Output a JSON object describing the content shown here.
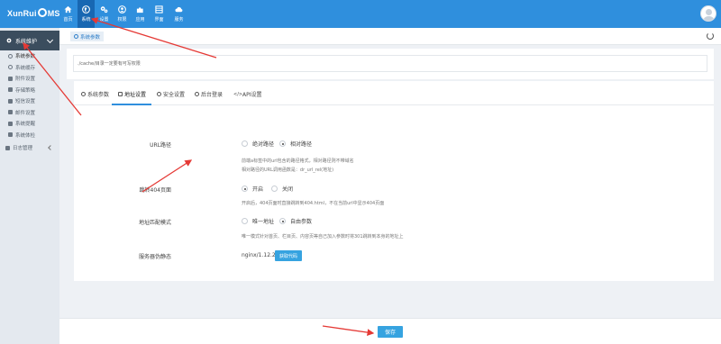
{
  "app": {
    "logo_text_left": "XunRui",
    "logo_text_right": "MS"
  },
  "topnav": {
    "items": [
      {
        "label": "首页",
        "icon": "home-icon",
        "active": false
      },
      {
        "label": "系统",
        "icon": "globe-icon",
        "active": true
      },
      {
        "label": "设置",
        "icon": "gears-icon",
        "active": false
      },
      {
        "label": "权限",
        "icon": "user-circle-icon",
        "active": false
      },
      {
        "label": "应用",
        "icon": "puzzle-icon",
        "active": false
      },
      {
        "label": "界面",
        "icon": "layout-icon",
        "active": false
      },
      {
        "label": "服务",
        "icon": "cloud-icon",
        "active": false
      }
    ]
  },
  "sidebar": {
    "header": "系统维护",
    "items": [
      {
        "label": "系统参数",
        "icon": "gear-icon"
      },
      {
        "label": "系统缓存",
        "icon": "refresh-icon"
      },
      {
        "label": "附件设置",
        "icon": "folder-icon"
      },
      {
        "label": "存储策略",
        "icon": "cloud-icon"
      },
      {
        "label": "短信设置",
        "icon": "envelope-icon"
      },
      {
        "label": "邮件设置",
        "icon": "mail-icon"
      },
      {
        "label": "系统提醒",
        "icon": "bell-icon"
      },
      {
        "label": "系统体检",
        "icon": "wrench-icon"
      }
    ],
    "group": "日志管理"
  },
  "breadcrumb": {
    "label": "系统参数"
  },
  "notice": {
    "text": "./cache/目录一定要有可写权限"
  },
  "tabs": [
    {
      "label": "系统参数"
    },
    {
      "label": "地址设置"
    },
    {
      "label": "安全设置"
    },
    {
      "label": "后台登录"
    },
    {
      "label": "API设置"
    }
  ],
  "form": {
    "url_path": {
      "label": "URL路径",
      "options": [
        "绝对路径",
        "相对路径"
      ],
      "selected": "相对路径",
      "help1": "前端a标签中的url包含的路径格式，相对路径则不带域名",
      "help2": "相对路径的URL调用函数是：dr_url_rel(地址)"
    },
    "jump404": {
      "label": "跳转404页面",
      "options": [
        "开启",
        "关闭"
      ],
      "selected": "开启",
      "help": "开启后，404页面时直接跳转到404.html，不在当前url中显示404页面"
    },
    "match": {
      "label": "地址匹配模式",
      "options": [
        "唯一地址",
        "自由参数"
      ],
      "selected": "自由参数",
      "help": "唯一模式针对首页、栏目页、内容页等自己加入参数时将301跳转到本身的地址上"
    },
    "server": {
      "label": "服务器伪静态",
      "value": "nginx/1.12.2",
      "button": "获取代码"
    }
  },
  "footer": {
    "save_label": "保存"
  },
  "colors": {
    "topbar": "#2f8fdd",
    "sidebar_header": "#3b4d5e",
    "button": "#36a3e0",
    "annotation": "#e53935"
  }
}
